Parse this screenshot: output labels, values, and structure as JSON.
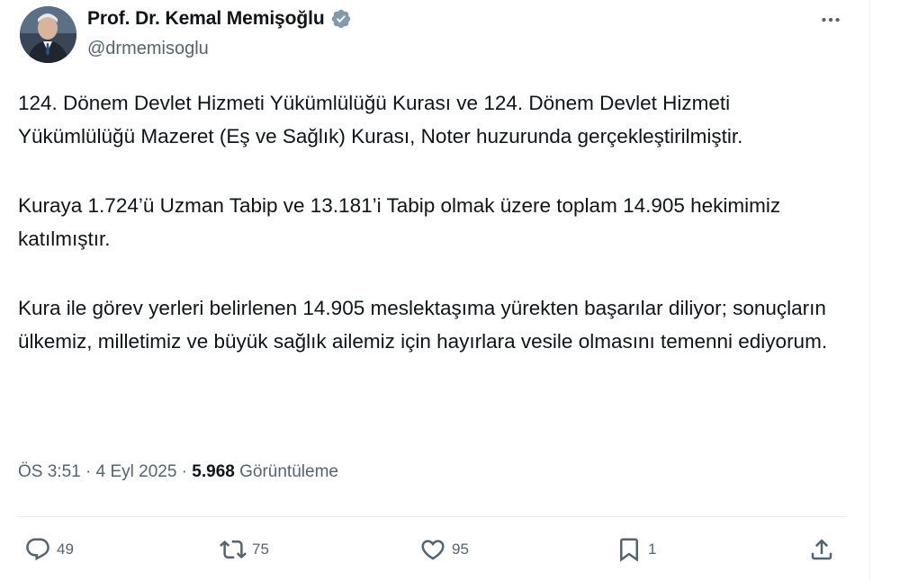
{
  "author": {
    "display_name": "Prof. Dr. Kemal Memişoğlu",
    "handle": "@drmemisoglu",
    "verified_icon": "verified-badge-icon",
    "avatar_icon": "profile-photo"
  },
  "tweet": {
    "paragraphs": [
      "124. Dönem Devlet Hizmeti Yükümlülüğü Kurası ve 124. Dönem Devlet Hizmeti Yükümlülüğü Mazeret (Eş ve Sağlık) Kurası, Noter huzurunda gerçekleştirilmiştir.",
      "Kuraya 1.724’ü Uzman Tabip ve 13.181’i Tabip olmak üzere toplam 14.905 hekimimiz katılmıştır.",
      "Kura ile görev yerleri belirlenen 14.905 meslektaşıma yürekten başarılar diliyor; sonuçların ülkemiz, milletimiz ve büyük sağlık ailemiz için hayırlara vesile olmasını temenni ediyorum."
    ]
  },
  "meta": {
    "time": "ÖS 3:51",
    "separator": " · ",
    "date": "4 Eyl 2025",
    "views_count": "5.968",
    "views_label": "Görüntüleme"
  },
  "actions": {
    "reply": {
      "icon": "reply-icon",
      "count": "49"
    },
    "retweet": {
      "icon": "retweet-icon",
      "count": "75"
    },
    "like": {
      "icon": "heart-icon",
      "count": "95"
    },
    "bookmark": {
      "icon": "bookmark-icon",
      "count": "1"
    },
    "share": {
      "icon": "share-icon"
    }
  },
  "colors": {
    "text_primary": "#0f1419",
    "text_secondary": "#536471",
    "verified_badge": "#829aab",
    "divider": "#e7ecef"
  }
}
